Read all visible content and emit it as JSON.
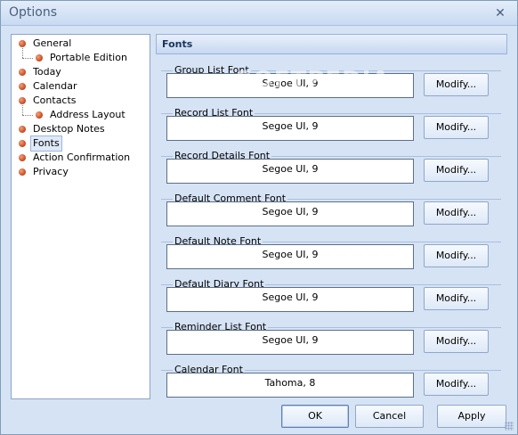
{
  "window": {
    "title": "Options",
    "close_glyph": "✕"
  },
  "tree": {
    "items": [
      {
        "label": "General",
        "level": 0
      },
      {
        "label": "Portable Edition",
        "level": 1
      },
      {
        "label": "Today",
        "level": 0
      },
      {
        "label": "Calendar",
        "level": 0
      },
      {
        "label": "Contacts",
        "level": 0
      },
      {
        "label": "Address Layout",
        "level": 1
      },
      {
        "label": "Desktop Notes",
        "level": 0
      },
      {
        "label": "Fonts",
        "level": 0,
        "selected": true
      },
      {
        "label": "Action Confirmation",
        "level": 0
      },
      {
        "label": "Privacy",
        "level": 0
      }
    ]
  },
  "panel": {
    "header": "Fonts",
    "groups": [
      {
        "title": "Group List Font",
        "value": "Segoe UI, 9",
        "button": "Modify..."
      },
      {
        "title": "Record List Font",
        "value": "Segoe UI, 9",
        "button": "Modify..."
      },
      {
        "title": "Record Details Font",
        "value": "Segoe UI, 9",
        "button": "Modify..."
      },
      {
        "title": "Default Comment Font",
        "value": "Segoe UI, 9",
        "button": "Modify..."
      },
      {
        "title": "Default Note Font",
        "value": "Segoe UI, 9",
        "button": "Modify..."
      },
      {
        "title": "Default Diary Font",
        "value": "Segoe UI, 9",
        "button": "Modify..."
      },
      {
        "title": "Reminder List Font",
        "value": "Segoe UI, 9",
        "button": "Modify..."
      },
      {
        "title": "Calendar Font",
        "value": "Tahoma, 8",
        "button": "Modify..."
      }
    ]
  },
  "footer": {
    "ok": "OK",
    "cancel": "Cancel",
    "apply": "Apply"
  },
  "watermark": "SOFTPEDIA",
  "colors": {
    "window_bg": "#d6e3f5",
    "bullet": "#c8441b",
    "header_text": "#17365d"
  }
}
